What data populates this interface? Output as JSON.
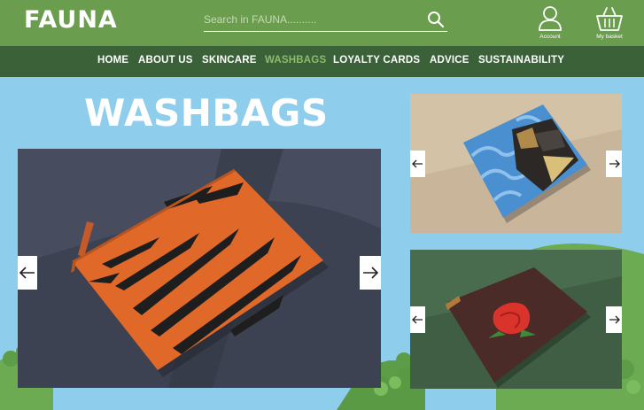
{
  "brand": {
    "logo_text": "FAUNA"
  },
  "search": {
    "placeholder": "Search in FAUNA.........."
  },
  "header": {
    "account_label": "Account",
    "basket_label": "My basket"
  },
  "nav": {
    "items": [
      {
        "label": "HOME"
      },
      {
        "label": "ABOUT US"
      },
      {
        "label": "SKINCARE"
      },
      {
        "label": "WASHBAGS",
        "active": true
      },
      {
        "label": "LOYALTY CARDS"
      },
      {
        "label": "ADVICE"
      },
      {
        "label": "SUSTAINABILITY"
      }
    ]
  },
  "page": {
    "title": "WASHBAGS"
  },
  "colors": {
    "header_green": "#6a9d4e",
    "nav_green": "#3b6138",
    "active_nav": "#8dbb6b",
    "sky_blue": "#8fcdec",
    "tiger_orange": "#e0692a",
    "monkey_bag_blue": "#4a8fcf",
    "rose_bag_brown": "#4a2b27"
  },
  "icons": [
    "search-icon",
    "account-icon",
    "basket-icon",
    "arrow-left-icon",
    "arrow-right-icon"
  ]
}
